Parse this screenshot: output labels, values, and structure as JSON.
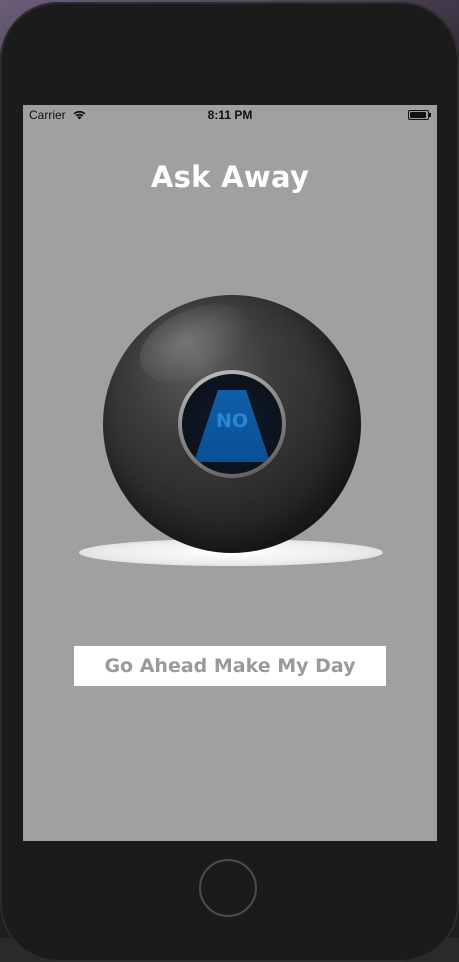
{
  "status_bar": {
    "carrier": "Carrier",
    "time": "8:11 PM"
  },
  "app": {
    "title": "Ask Away",
    "answer": "NO",
    "action_button_label": "Go Ahead Make My Day"
  },
  "colors": {
    "screen_background": "#a0a0a0",
    "title_text": "#ffffff",
    "answer_text": "#2a86d6",
    "button_background": "#ffffff",
    "button_text": "#9a9a9a"
  },
  "icons": {
    "wifi": "wifi-icon",
    "battery": "battery-icon",
    "home": "home-button"
  }
}
